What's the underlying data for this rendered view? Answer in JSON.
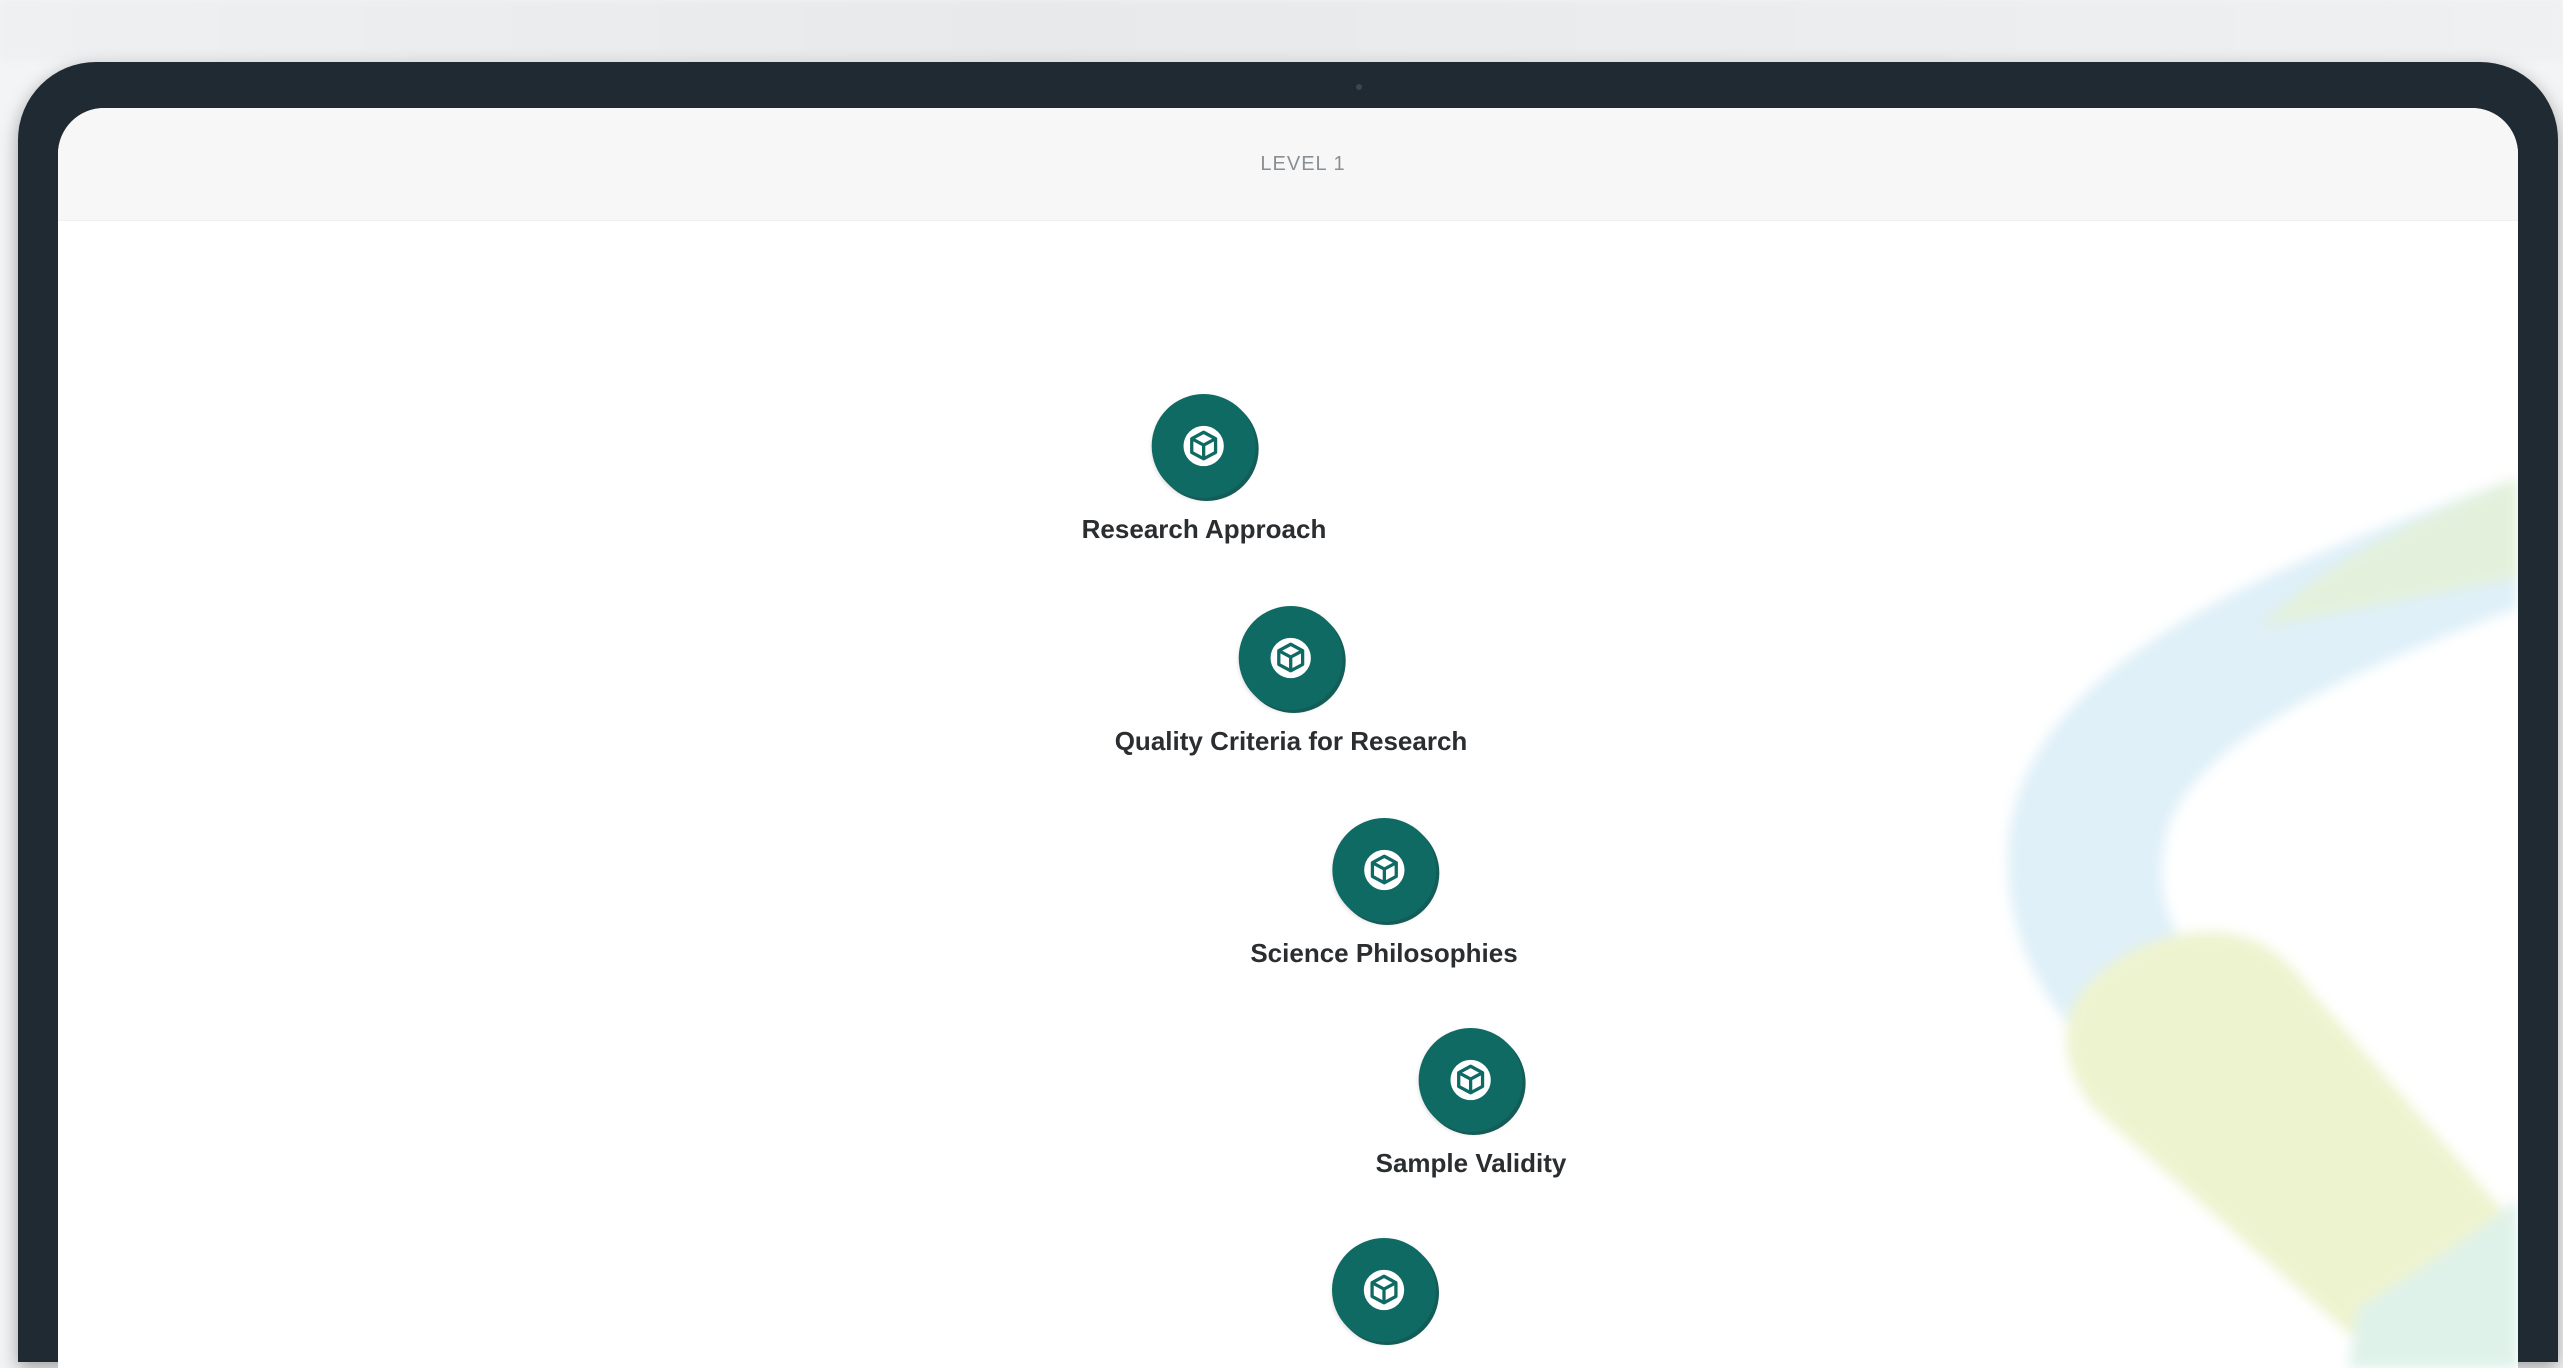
{
  "level_title": "LEVEL 1",
  "nodes": [
    {
      "label": "Research Approach",
      "icon": "cube-icon"
    },
    {
      "label": "Quality Criteria for Research",
      "icon": "cube-icon"
    },
    {
      "label": "Science Philosophies",
      "icon": "cube-icon"
    },
    {
      "label": "Sample Validity",
      "icon": "cube-icon"
    },
    {
      "label": "",
      "icon": "cube-icon"
    }
  ],
  "colors": {
    "node_fill": "#0f6a64",
    "device_frame": "#1f2a33",
    "deco_blue": "#dff0f8",
    "deco_yellow": "#eef3cf",
    "deco_green": "#e7f3d9"
  }
}
